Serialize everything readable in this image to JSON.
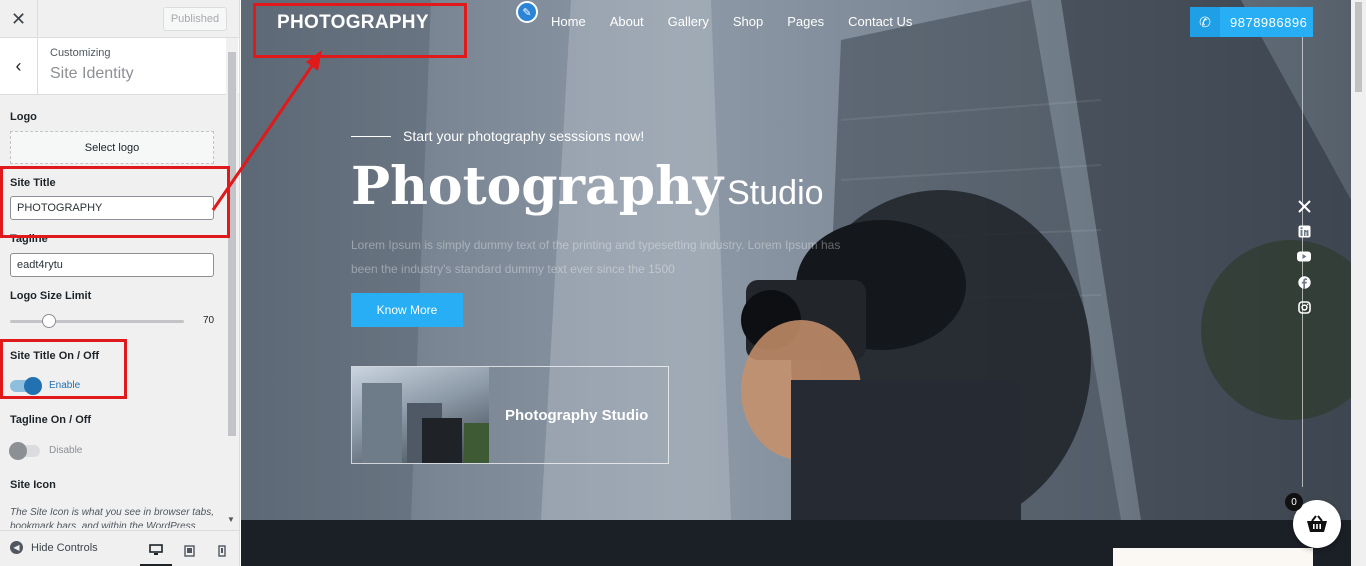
{
  "panel": {
    "close_glyph": "✕",
    "published_label": "Published",
    "back_glyph": "‹",
    "customizing_label": "Customizing",
    "section_title": "Site Identity",
    "logo": {
      "label": "Logo",
      "button_label": "Select logo"
    },
    "site_title": {
      "label": "Site Title",
      "value": "PHOTOGRAPHY"
    },
    "tagline": {
      "label": "Tagline",
      "value": "eadt4rytu"
    },
    "logo_size": {
      "label": "Logo Size Limit",
      "value": "70",
      "level_percent": 18
    },
    "site_title_toggle": {
      "label": "Site Title On / Off",
      "state_label": "Enable"
    },
    "tagline_toggle": {
      "label": "Tagline On / Off",
      "state_label": "Disable"
    },
    "site_icon": {
      "label": "Site Icon",
      "description": "The Site Icon is what you see in browser tabs, bookmark bars, and within the WordPress"
    },
    "footer": {
      "hide_controls_label": "Hide Controls"
    }
  },
  "preview": {
    "site_title": "PHOTOGRAPHY",
    "nav": [
      "Home",
      "About",
      "Gallery",
      "Shop",
      "Pages",
      "Contact Us"
    ],
    "phone": "9878986896",
    "kicker": "Start your photography sesssions now!",
    "headline_big": "Photography",
    "headline_small": "Studio",
    "lorem": "Lorem Ipsum is simply dummy text of the printing and typesetting industry. Lorem Ipsum has been the industry's standard dummy text ever since the 1500",
    "button_label": "Know More",
    "card_label": "Photography Studio",
    "social_icons": [
      "x-icon",
      "linkedin-icon",
      "youtube-icon",
      "facebook-icon",
      "instagram-icon"
    ],
    "cart_count": "0"
  },
  "colors": {
    "highlight": "#e0191a",
    "accent": "#28aef5",
    "wp_blue": "#2271b1"
  }
}
